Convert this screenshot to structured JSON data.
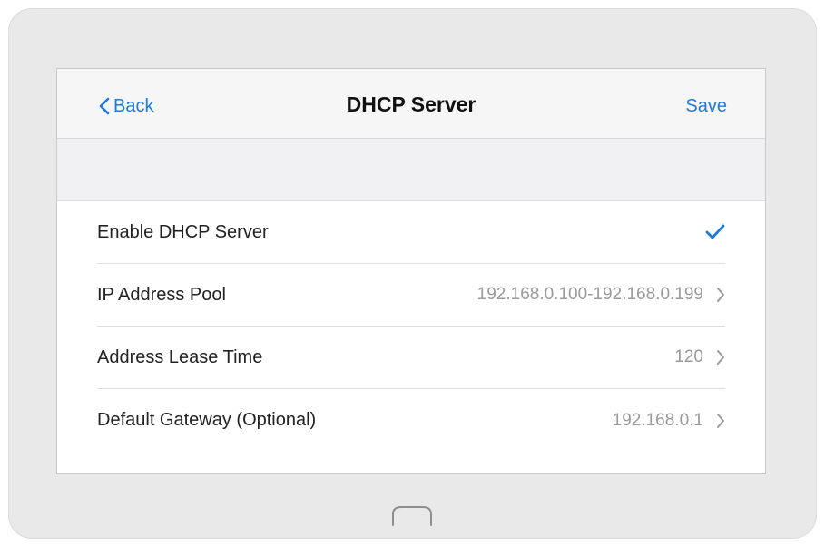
{
  "nav": {
    "back_label": "Back",
    "title": "DHCP Server",
    "save_label": "Save"
  },
  "rows": [
    {
      "label": "Enable DHCP Server",
      "value": "",
      "control": "checkmark-icon",
      "checked": true
    },
    {
      "label": "IP Address Pool",
      "value": "192.168.0.100-192.168.0.199",
      "control": "chevron-right-icon"
    },
    {
      "label": "Address Lease Time",
      "value": "120",
      "control": "chevron-right-icon"
    },
    {
      "label": "Default Gateway (Optional)",
      "value": "192.168.0.1",
      "control": "chevron-right-icon"
    }
  ],
  "colors": {
    "accent": "#1a7be0",
    "device_frame": "#e9e9e9",
    "navbar_bg": "#f6f6f6",
    "section_bg": "#f0f0f3",
    "value_text": "#9a9a9a"
  },
  "icons": {
    "back": "chevron-left-icon",
    "home": "home-button-icon"
  }
}
